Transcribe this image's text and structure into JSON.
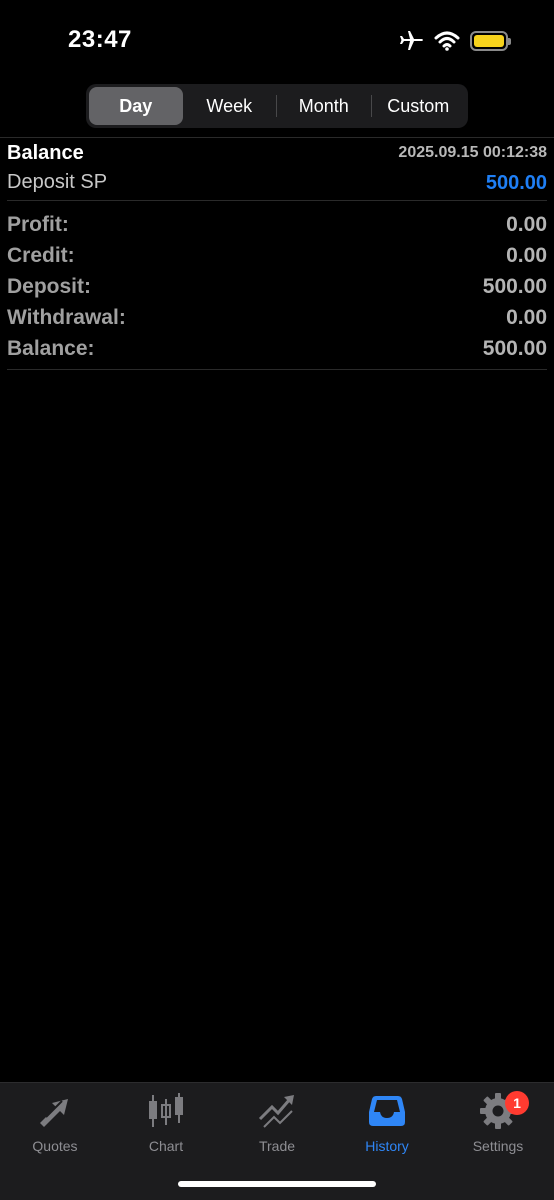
{
  "status_bar": {
    "time": "23:47",
    "icons": [
      "airplane-icon",
      "wifi-icon",
      "battery-icon"
    ],
    "battery_color": "#f7d31c"
  },
  "period_tabs": {
    "items": [
      {
        "label": "Day",
        "active": true
      },
      {
        "label": "Week",
        "active": false
      },
      {
        "label": "Month",
        "active": false
      },
      {
        "label": "Custom",
        "active": false
      }
    ]
  },
  "entry": {
    "type": "Balance",
    "datetime": "2025.09.15 00:12:38",
    "description": "Deposit SP",
    "amount": "500.00",
    "amount_color": "#1f7ff5"
  },
  "summary": {
    "rows": [
      {
        "label": "Profit:",
        "value": "0.00"
      },
      {
        "label": "Credit:",
        "value": "0.00"
      },
      {
        "label": "Deposit:",
        "value": "500.00"
      },
      {
        "label": "Withdrawal:",
        "value": "0.00"
      },
      {
        "label": "Balance:",
        "value": "500.00"
      }
    ]
  },
  "tab_bar": {
    "items": [
      {
        "label": "Quotes",
        "icon": "quotes-arrows-icon",
        "active": false
      },
      {
        "label": "Chart",
        "icon": "candlestick-chart-icon",
        "active": false
      },
      {
        "label": "Trade",
        "icon": "trade-trend-icon",
        "active": false
      },
      {
        "label": "History",
        "icon": "inbox-tray-icon",
        "active": true
      },
      {
        "label": "Settings",
        "icon": "gear-icon",
        "active": false,
        "badge": "1"
      }
    ],
    "active_color": "#2f86f6"
  }
}
